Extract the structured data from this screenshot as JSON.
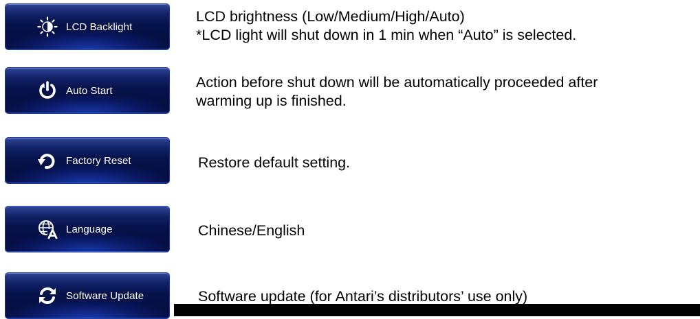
{
  "settings": [
    {
      "button_label": "LCD Backlight",
      "icon": "brightness-icon",
      "description_lines": [
        "LCD brightness (Low/Medium/High/Auto)",
        "*LCD light will shut down in 1 min when “Auto” is selected."
      ]
    },
    {
      "button_label": "Auto Start",
      "icon": "power-cycle-icon",
      "description_lines": [
        "Action before shut down will be automatically proceeded after",
        "warming up is finished."
      ]
    },
    {
      "button_label": "Factory Reset",
      "icon": "reset-arrow-icon",
      "description_lines": [
        "Restore default setting."
      ]
    },
    {
      "button_label": "Language",
      "icon": "globe-language-icon",
      "description_lines": [
        "Chinese/English"
      ]
    },
    {
      "button_label": "Software Update",
      "icon": "refresh-sync-icon",
      "description_lines": [
        "Software update (for Antari’s distributors’ use only)"
      ]
    }
  ],
  "colors": {
    "button_background": "#06124a",
    "button_border": "#1b3aa0",
    "button_text": "#ffffff",
    "description_text": "#000000"
  }
}
